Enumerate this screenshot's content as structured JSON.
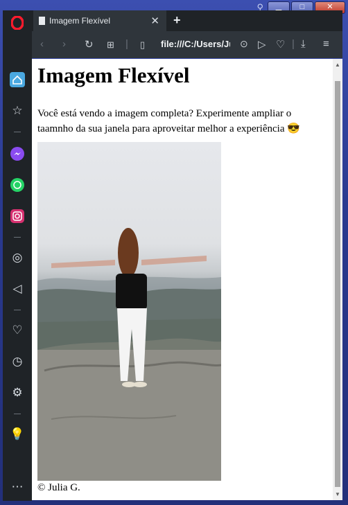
{
  "window": {
    "minimize": "▁",
    "maximize": "□",
    "close": "✕"
  },
  "tab": {
    "title": "Imagem Flexível"
  },
  "toolbar": {
    "url": "file:///C:/Users/Ju"
  },
  "page": {
    "heading": "Imagem Flexível",
    "paragraph": "Você está vendo a imagem completa? Experimente ampliar o taamnho da sua janela para aproveitar melhor a experiência 😎",
    "credit": "© Julia G."
  },
  "colors": {
    "browser_dark": "#1f2327",
    "toolbar": "#2f353b",
    "opera_red": "#ff1b2d"
  }
}
